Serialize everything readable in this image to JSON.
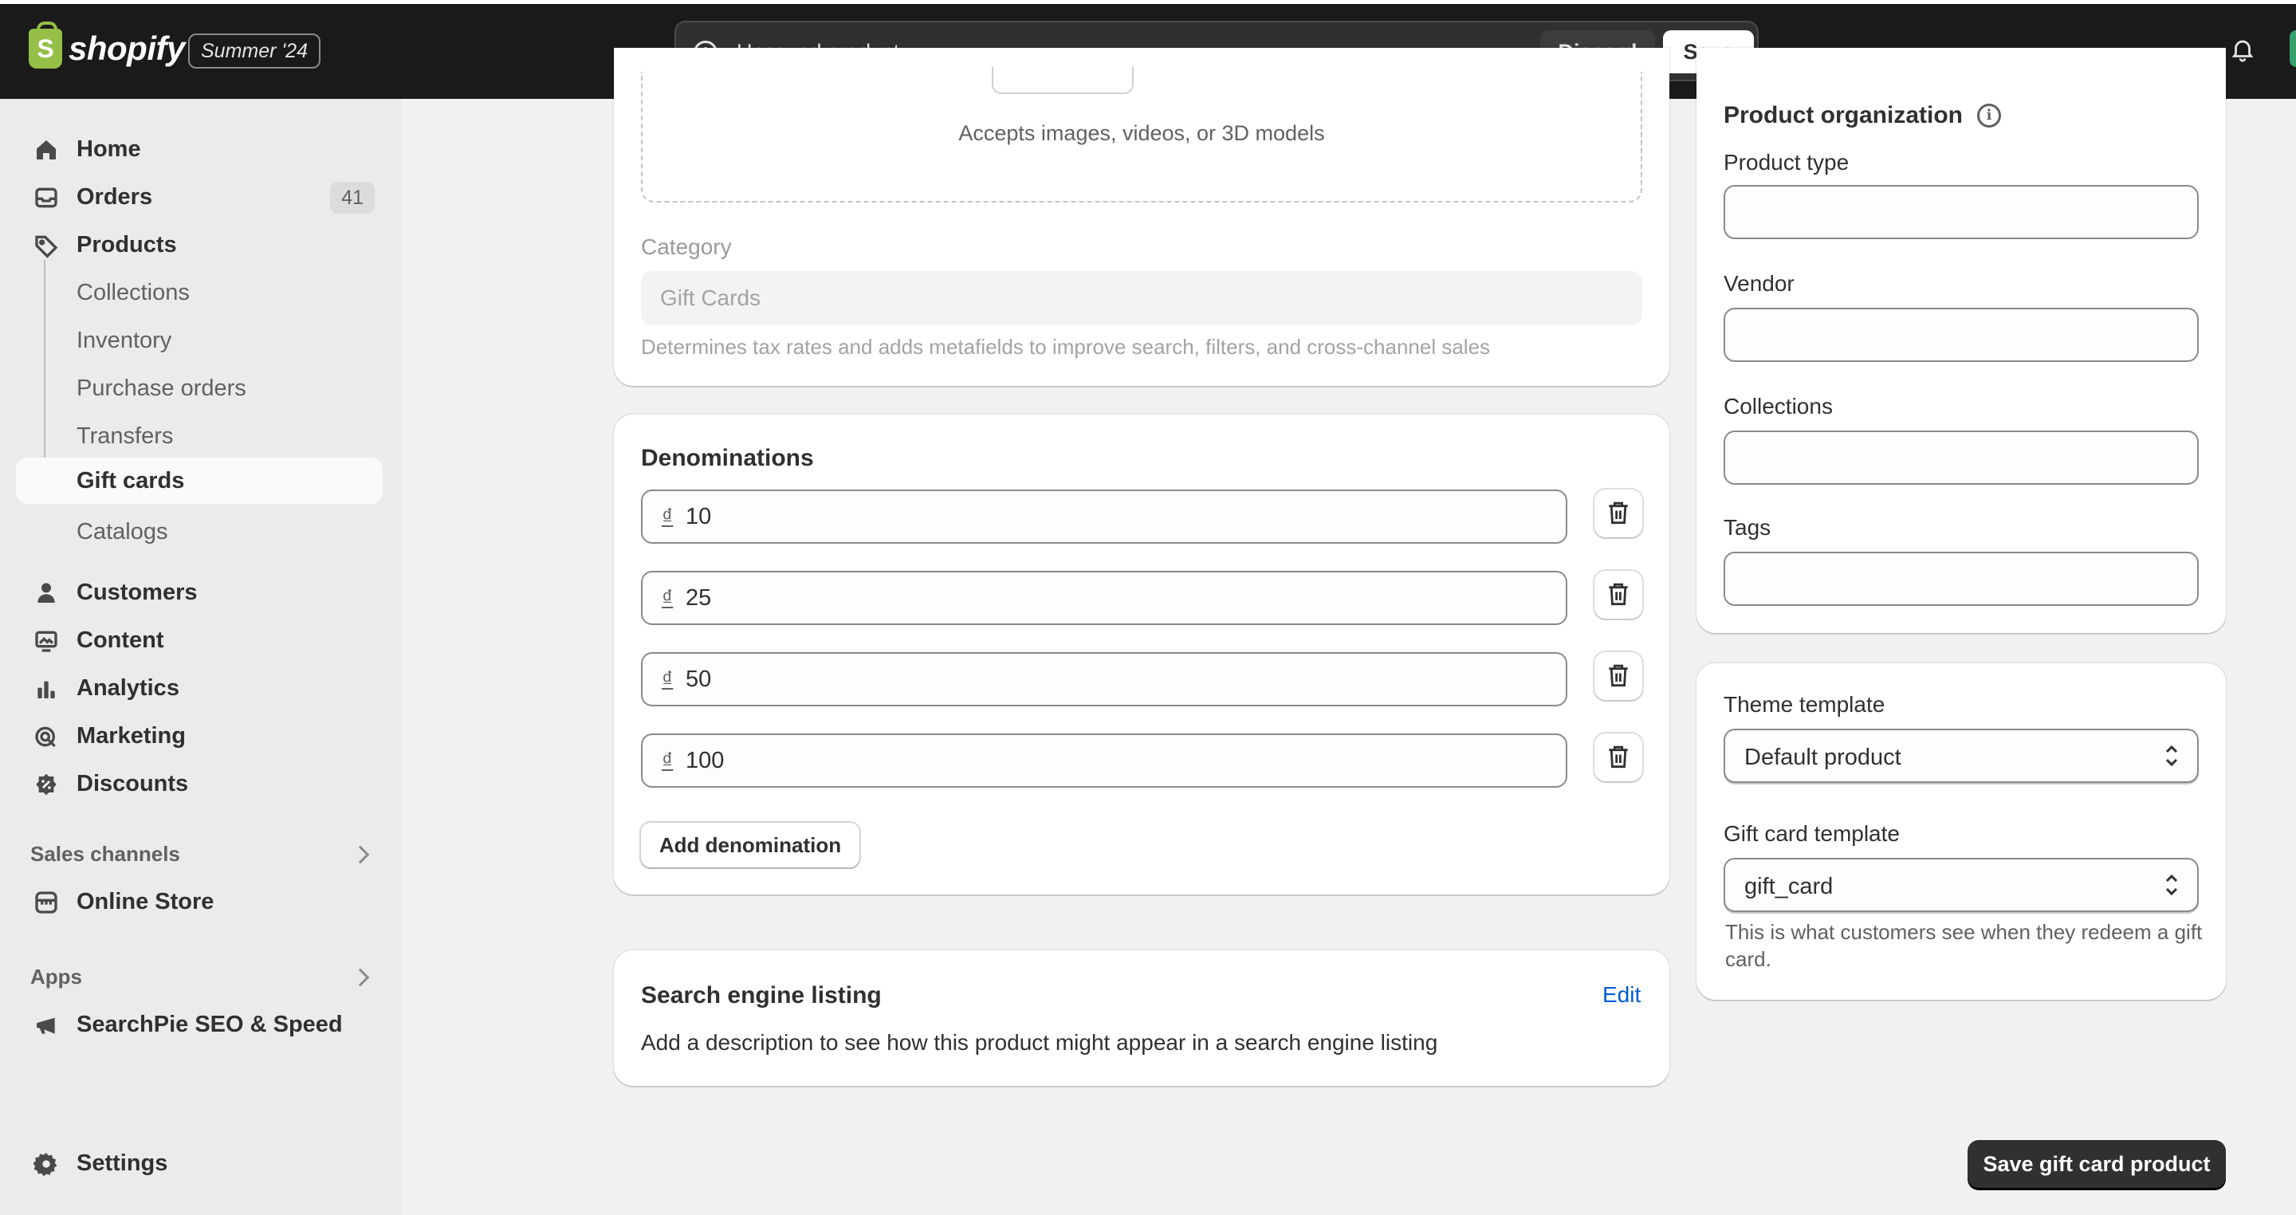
{
  "header": {
    "brand": "shopify",
    "edition": "Summer '24",
    "unsaved_message": "Unsaved product",
    "discard_label": "Discard",
    "save_label": "Save"
  },
  "sidebar": {
    "items": [
      {
        "label": "Home",
        "icon": "home-icon"
      },
      {
        "label": "Orders",
        "icon": "inbox-icon",
        "badge": "41"
      },
      {
        "label": "Products",
        "icon": "tag-icon"
      },
      {
        "label": "Collections"
      },
      {
        "label": "Inventory"
      },
      {
        "label": "Purchase orders"
      },
      {
        "label": "Transfers"
      },
      {
        "label": "Gift cards",
        "active": true
      },
      {
        "label": "Catalogs"
      },
      {
        "label": "Customers",
        "icon": "person-icon"
      },
      {
        "label": "Content",
        "icon": "image-icon"
      },
      {
        "label": "Analytics",
        "icon": "bar-chart-icon"
      },
      {
        "label": "Marketing",
        "icon": "target-icon"
      },
      {
        "label": "Discounts",
        "icon": "discount-icon"
      }
    ],
    "sales_channels_heading": "Sales channels",
    "online_store": "Online Store",
    "apps_heading": "Apps",
    "app_item": "SearchPie SEO & Speed",
    "settings": "Settings"
  },
  "media": {
    "accepts_text": "Accepts images, videos, or 3D models"
  },
  "category": {
    "label": "Category",
    "value": "Gift Cards",
    "help": "Determines tax rates and adds metafields to improve search, filters, and cross-channel sales"
  },
  "denominations": {
    "title": "Denominations",
    "currency_symbol": "₫",
    "values": [
      "10",
      "25",
      "50",
      "100"
    ],
    "add_label": "Add denomination"
  },
  "seo": {
    "title": "Search engine listing",
    "edit_label": "Edit",
    "description": "Add a description to see how this product might appear in a search engine listing"
  },
  "organization": {
    "title": "Product organization",
    "product_type_label": "Product type",
    "vendor_label": "Vendor",
    "collections_label": "Collections",
    "tags_label": "Tags"
  },
  "templates": {
    "theme_label": "Theme template",
    "theme_value": "Default product",
    "gift_label": "Gift card template",
    "gift_value": "gift_card",
    "gift_help": "This is what customers see when they redeem a gift card."
  },
  "footer": {
    "primary_label": "Save gift card product"
  },
  "colors": {
    "topbar": "#1a1a1a",
    "accent_link": "#005bd3",
    "brand_green": "#95bf47",
    "page_bg": "#f1f1f1"
  }
}
